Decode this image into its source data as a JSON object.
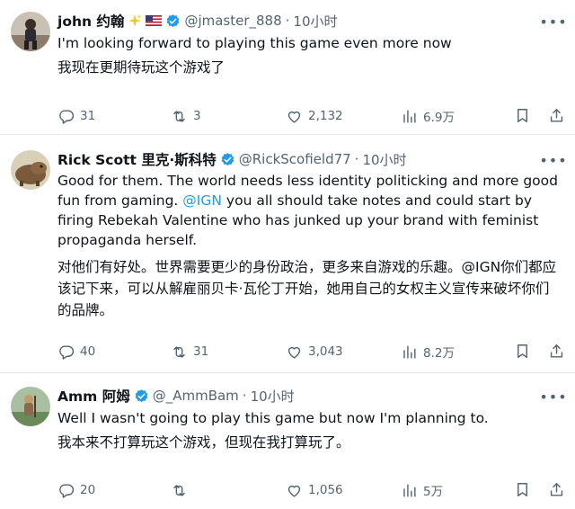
{
  "tweets": [
    {
      "name": "john 约翰",
      "handle": "@jmaster_888",
      "time": "10小时",
      "text_en": "I'm looking forward to playing this game even more now",
      "text_cn": "我现在更期待玩这个游戏了",
      "stats": {
        "replies": "31",
        "retweets": "3",
        "likes": "2,132",
        "views": "6.9万"
      }
    },
    {
      "name": "Rick Scott 里克·斯科特",
      "handle": "@RickScofield77",
      "time": "10小时",
      "text_en_1": "Good for them. The world needs less identity politicking and more good fun from gaming. ",
      "mention": "@IGN",
      "text_en_2": " you all should take notes and could start by firing Rebekah Valentine who has junked up your brand with feminist propaganda herself.",
      "text_cn": "对他们有好处。世界需要更少的身份政治，更多来自游戏的乐趣。@IGN你们都应该记下来，可以从解雇丽贝卡·瓦伦丁开始，她用自己的女权主义宣传来破坏你们的品牌。",
      "stats": {
        "replies": "40",
        "retweets": "31",
        "likes": "3,043",
        "views": "8.2万"
      }
    },
    {
      "name": "Amm 阿姆",
      "handle": "@_AmmBam",
      "time": "10小时",
      "text_en": "Well I wasn't going to play this game but now I'm planning to.",
      "text_cn": "我本来不打算玩这个游戏，但现在我打算玩了。",
      "stats": {
        "replies": "20",
        "retweets": "",
        "likes": "1,056",
        "views": "5万"
      }
    }
  ],
  "separator": "·",
  "colors": {
    "verified": "#1d9bf0",
    "muted": "#536471",
    "link": "#1d9bf0",
    "text": "#0f1419"
  },
  "icons": [
    "reply-icon",
    "retweet-icon",
    "like-icon",
    "views-icon",
    "bookmark-icon",
    "share-icon",
    "more-icon",
    "verified-badge-icon"
  ]
}
